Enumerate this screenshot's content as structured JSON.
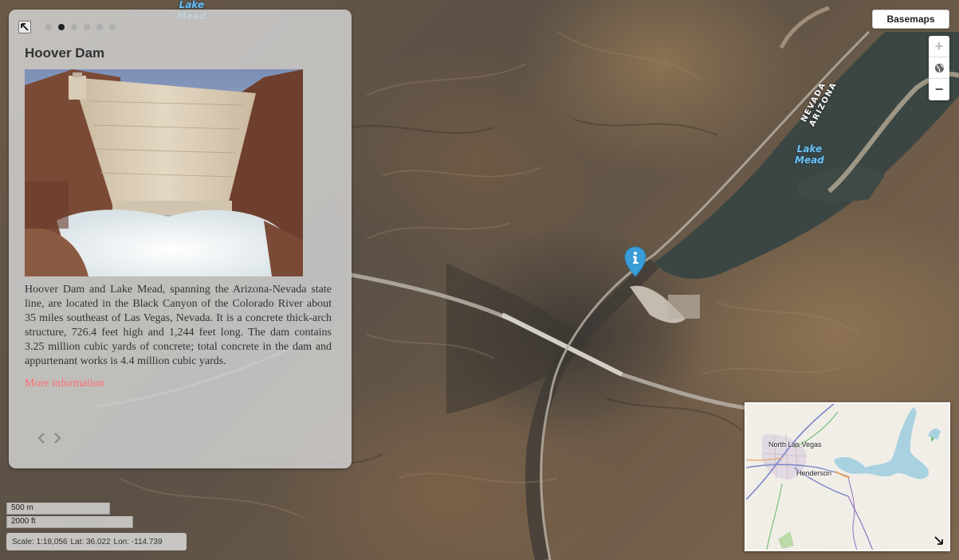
{
  "map": {
    "labels": {
      "lake_top": "Lake\nMead",
      "lake_right": "Lake\nMead",
      "state_line": "NEVADA\nARIZONA"
    }
  },
  "panel": {
    "title": "Hoover Dam",
    "description": "Hoover Dam and Lake Mead, spanning the Arizona-Nevada state line, are located in the Black Canyon of the Colorado River about 35 miles southeast of Las Vegas, Nevada. It is a concrete thick-arch structure, 726.4 feet high and 1,244 feet long. The dam contains 3.25 million cubic yards of concrete; total concrete in the dam and appurtenant works is 4.4 million cubic yards.",
    "more_link": "More information",
    "pages": {
      "count": 6,
      "active_index": 1
    }
  },
  "controls": {
    "basemaps_label": "Basemaps",
    "zoom_in": "+",
    "zoom_out": "−",
    "home_icon": "globe-icon"
  },
  "overview": {
    "labels": {
      "north_las_vegas": "North Las Vegas",
      "henderson": "Henderson"
    }
  },
  "scale": {
    "metric": "500 m",
    "imperial": "2000 ft"
  },
  "readout": {
    "scale": "Scale: 1:18,056",
    "lat": "Lat: 36.022",
    "lon": "Lon: -114.739"
  },
  "colors": {
    "accent_link": "#ff6b6b",
    "marker": "#3a9dd8",
    "water_label": "#6fc1ec"
  }
}
